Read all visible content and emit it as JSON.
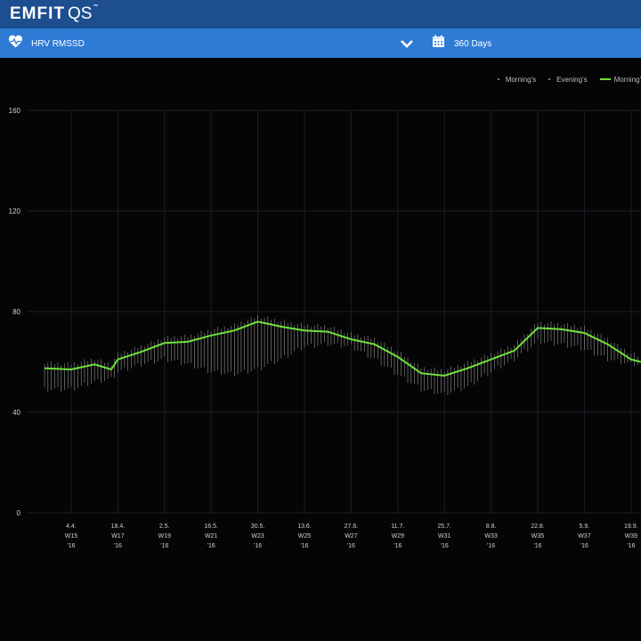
{
  "app": {
    "brand": "EMFIT",
    "brand_suffix": "QS",
    "brand_mark": "™"
  },
  "toolbar": {
    "metric_label": "HRV RMSSD",
    "range_label": "360 Days"
  },
  "legend": {
    "items": [
      "Morning's",
      "Evening's",
      "Morning'"
    ]
  },
  "colors": {
    "topbar": "#1d4e8f",
    "subbar": "#2e7bd6",
    "background": "#050505",
    "trend": "#6fe13a",
    "bars": "#a8a8a8",
    "grid": "#1b1f2a"
  },
  "chart_data": {
    "type": "line",
    "title": "",
    "xlabel": "",
    "ylabel": "",
    "ylim": [
      0,
      160
    ],
    "yticks": [
      0,
      40,
      80,
      120,
      160
    ],
    "x_ticks": [
      {
        "date": "4.4.",
        "week": "W15",
        "year": "'16"
      },
      {
        "date": "18.4.",
        "week": "W17",
        "year": "'16"
      },
      {
        "date": "2.5.",
        "week": "W19",
        "year": "'16"
      },
      {
        "date": "16.5.",
        "week": "W21",
        "year": "'16"
      },
      {
        "date": "30.5.",
        "week": "W23",
        "year": "'16"
      },
      {
        "date": "13.6.",
        "week": "W25",
        "year": "'16"
      },
      {
        "date": "27.6.",
        "week": "W27",
        "year": "'16"
      },
      {
        "date": "11.7.",
        "week": "W29",
        "year": "'16"
      },
      {
        "date": "25.7.",
        "week": "W31",
        "year": "'16"
      },
      {
        "date": "8.8.",
        "week": "W33",
        "year": "'16"
      },
      {
        "date": "22.8.",
        "week": "W35",
        "year": "'16"
      },
      {
        "date": "5.9.",
        "week": "W37",
        "year": "'16"
      },
      {
        "date": "19.9.",
        "week": "W39",
        "year": "'16"
      }
    ],
    "series": [
      {
        "name": "Morning'",
        "style": "line",
        "points": [
          [
            "2016-03-27",
            57.5
          ],
          [
            "2016-04-04",
            57
          ],
          [
            "2016-04-11",
            59
          ],
          [
            "2016-04-16",
            57
          ],
          [
            "2016-04-18",
            61
          ],
          [
            "2016-04-25",
            64
          ],
          [
            "2016-05-02",
            67.5
          ],
          [
            "2016-05-09",
            68
          ],
          [
            "2016-05-16",
            70.5
          ],
          [
            "2016-05-23",
            72.5
          ],
          [
            "2016-05-30",
            76
          ],
          [
            "2016-06-06",
            74
          ],
          [
            "2016-06-13",
            72.5
          ],
          [
            "2016-06-20",
            72
          ],
          [
            "2016-06-27",
            69
          ],
          [
            "2016-07-04",
            67
          ],
          [
            "2016-07-11",
            62
          ],
          [
            "2016-07-18",
            55.5
          ],
          [
            "2016-07-25",
            54.5
          ],
          [
            "2016-08-01",
            57.5
          ],
          [
            "2016-08-08",
            61
          ],
          [
            "2016-08-15",
            64.5
          ],
          [
            "2016-08-22",
            73.5
          ],
          [
            "2016-08-29",
            73
          ],
          [
            "2016-09-05",
            71.5
          ],
          [
            "2016-09-12",
            67
          ],
          [
            "2016-09-19",
            61
          ],
          [
            "2016-09-22",
            60
          ]
        ]
      },
      {
        "name": "Morning's",
        "style": "bars",
        "points": [
          [
            "2016-03-27",
            50
          ],
          [
            "2016-04-04",
            50
          ],
          [
            "2016-04-11",
            53
          ],
          [
            "2016-04-16",
            54
          ],
          [
            "2016-04-18",
            57
          ],
          [
            "2016-04-25",
            60
          ],
          [
            "2016-05-02",
            62
          ],
          [
            "2016-05-09",
            60
          ],
          [
            "2016-05-16",
            57
          ],
          [
            "2016-05-23",
            56
          ],
          [
            "2016-05-30",
            58
          ],
          [
            "2016-06-06",
            62
          ],
          [
            "2016-06-13",
            67
          ],
          [
            "2016-06-20",
            68
          ],
          [
            "2016-06-27",
            67
          ],
          [
            "2016-07-04",
            62
          ],
          [
            "2016-07-11",
            56
          ],
          [
            "2016-07-18",
            50
          ],
          [
            "2016-07-25",
            48
          ],
          [
            "2016-08-01",
            51
          ],
          [
            "2016-08-08",
            57
          ],
          [
            "2016-08-15",
            62
          ],
          [
            "2016-08-22",
            69
          ],
          [
            "2016-08-29",
            68
          ],
          [
            "2016-09-05",
            66
          ],
          [
            "2016-09-12",
            62
          ],
          [
            "2016-09-19",
            60
          ],
          [
            "2016-09-22",
            60
          ]
        ]
      }
    ]
  }
}
